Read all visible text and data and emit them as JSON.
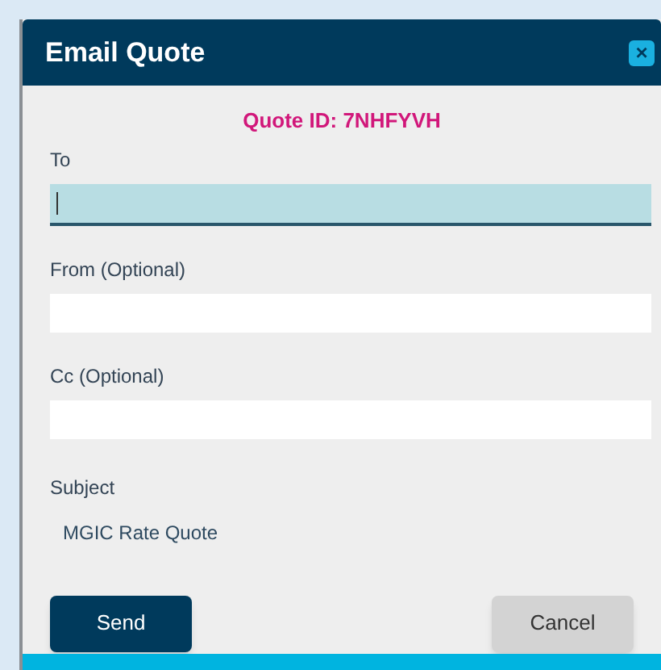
{
  "dialog": {
    "title": "Email Quote",
    "close_icon": "×"
  },
  "quote_id": "Quote ID: 7NHFYVH",
  "fields": [
    {
      "label": "To",
      "focused": true
    },
    {
      "label": "From (Optional)",
      "focused": false
    },
    {
      "label": "Cc (Optional)",
      "focused": false
    }
  ],
  "subject": {
    "label": "Subject",
    "value": "MGIC Rate Quote"
  },
  "buttons": [
    {
      "label": "Send",
      "kind": "primary"
    },
    {
      "label": "Cancel",
      "kind": "secondary"
    }
  ]
}
